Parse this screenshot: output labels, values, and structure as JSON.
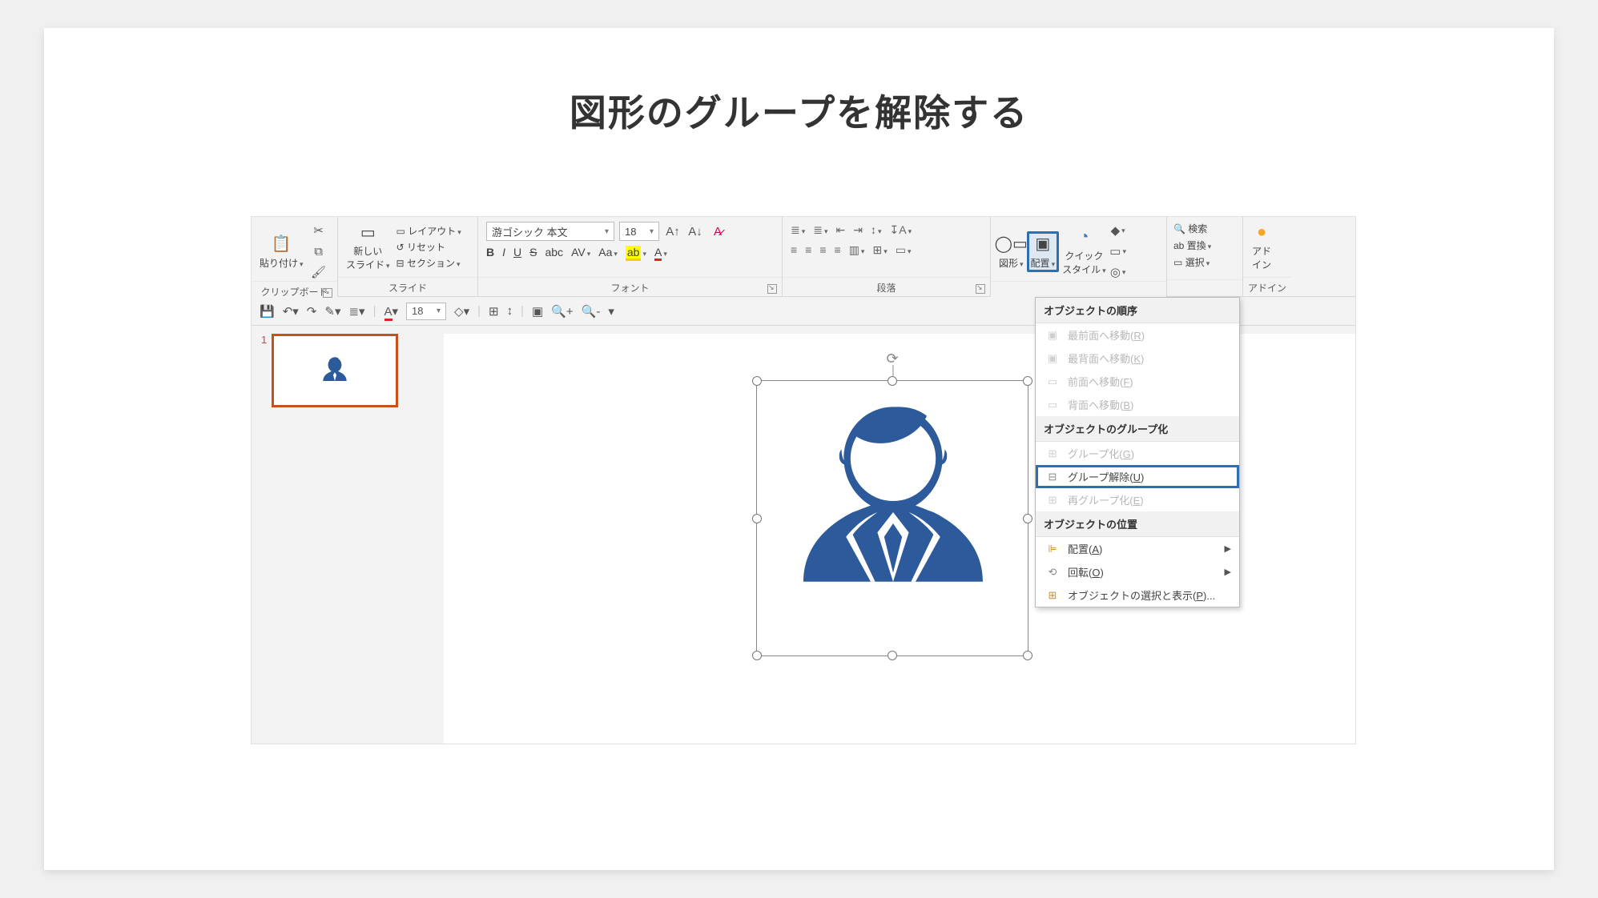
{
  "page_title": "図形のグループを解除する",
  "ribbon": {
    "clipboard": {
      "paste": "貼り付け",
      "label": "クリップボード"
    },
    "slides": {
      "new_slide": "新しい\nスライド",
      "layout": "レイアウト",
      "reset": "リセット",
      "section": "セクション",
      "label": "スライド"
    },
    "font": {
      "name": "游ゴシック 本文",
      "size": "18",
      "label": "フォント"
    },
    "paragraph": {
      "label": "段落"
    },
    "drawing": {
      "shapes": "図形",
      "arrange": "配置",
      "quickstyles": "クイック\nスタイル"
    },
    "editing": {
      "find": "検索",
      "replace": "置換",
      "select": "選択"
    },
    "addins": {
      "label": "アドイン",
      "btn": "アド\nイン"
    }
  },
  "qat_size": "18",
  "thumb_number": "1",
  "menu": {
    "h1": "オブジェクトの順序",
    "bring_front": "最前面へ移動(R)",
    "send_back": "最背面へ移動(K)",
    "forward": "前面へ移動(F)",
    "backward": "背面へ移動(B)",
    "h2": "オブジェクトのグループ化",
    "group": "グループ化(G)",
    "ungroup": "グループ解除(U)",
    "regroup": "再グループ化(E)",
    "h3": "オブジェクトの位置",
    "align": "配置(A)",
    "rotate": "回転(O)",
    "selpane": "オブジェクトの選択と表示(P)..."
  }
}
